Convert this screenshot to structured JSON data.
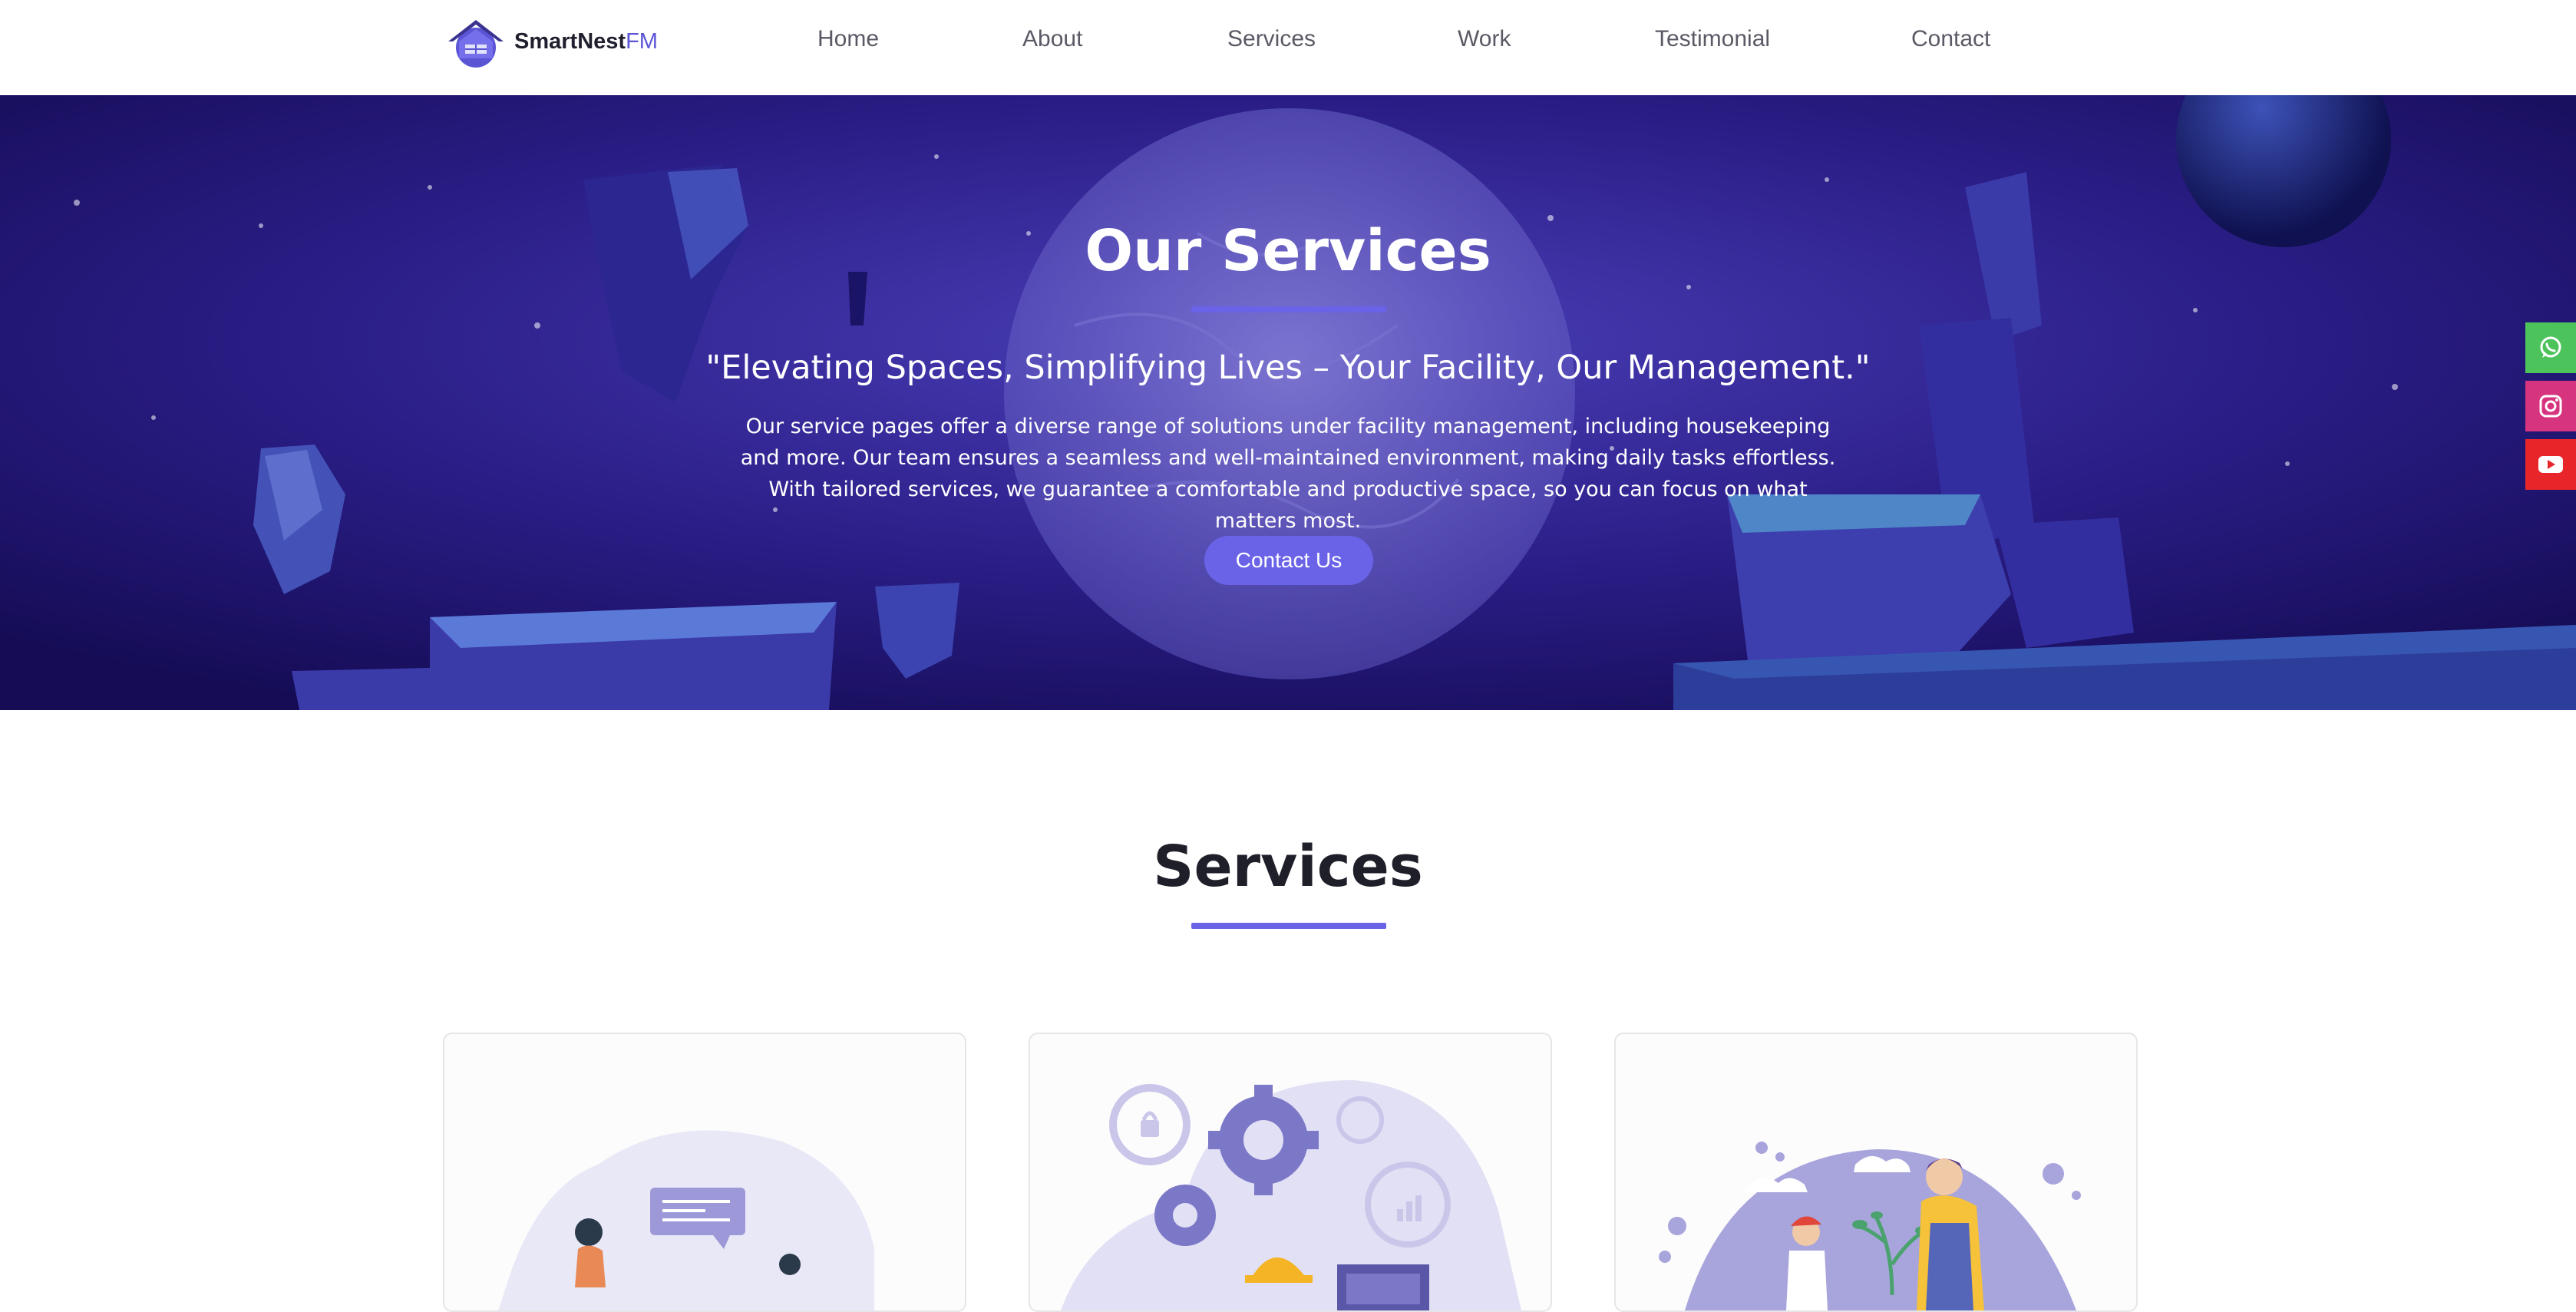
{
  "nav": {
    "brand_main": "SmartNest",
    "brand_accent": "FM",
    "links": [
      "Home",
      "About",
      "Services",
      "Work",
      "Testimonial",
      "Contact"
    ]
  },
  "hero": {
    "title": "Our Services",
    "quote": "\"Elevating Spaces, Simplifying Lives – Your Facility, Our Management.\"",
    "description": "Our service pages offer a diverse range of solutions under facility management, including housekeeping and more. Our team ensures a seamless and well-maintained environment, making daily tasks effortless. With tailored services, we guarantee a comfortable and productive space, so you can focus on what matters most.",
    "button_label": "Contact Us"
  },
  "social": {
    "icons": [
      "whatsapp-icon",
      "instagram-icon",
      "youtube-icon"
    ]
  },
  "services": {
    "title": "Services",
    "cards": [
      {
        "illustration": "meeting-illustration"
      },
      {
        "illustration": "engineering-illustration"
      },
      {
        "illustration": "gardening-illustration"
      }
    ]
  },
  "colors": {
    "accent": "#6a63e8",
    "whatsapp": "#4cc35b",
    "instagram": "#d6347f",
    "youtube": "#e8262a",
    "hero_bg": "#2a1a7a"
  }
}
